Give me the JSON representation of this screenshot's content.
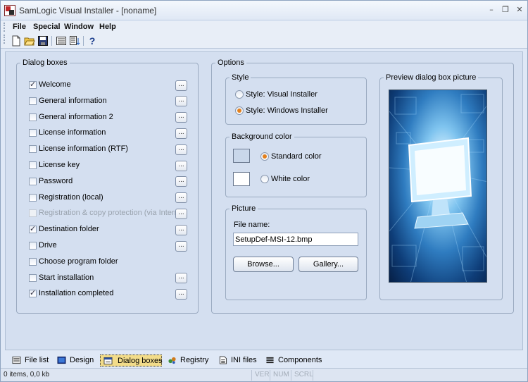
{
  "window": {
    "title": "SamLogic Visual Installer - [noname]"
  },
  "menu": {
    "items": [
      "File",
      "Special",
      "Window",
      "Help"
    ]
  },
  "toolbar": {
    "icons": [
      "new-file-icon",
      "open-folder-icon",
      "save-icon",
      "list-view-icon",
      "import-icon",
      "help-icon"
    ],
    "help_glyph": "?"
  },
  "dialog_boxes": {
    "legend": "Dialog boxes",
    "button_label": "...",
    "items": [
      {
        "label": "Welcome",
        "checked": true,
        "disabled": false,
        "has_button": true
      },
      {
        "label": "General information",
        "checked": false,
        "disabled": false,
        "has_button": true
      },
      {
        "label": "General information 2",
        "checked": false,
        "disabled": false,
        "has_button": true
      },
      {
        "label": "License information",
        "checked": false,
        "disabled": false,
        "has_button": true
      },
      {
        "label": "License information (RTF)",
        "checked": false,
        "disabled": false,
        "has_button": true
      },
      {
        "label": "License key",
        "checked": false,
        "disabled": false,
        "has_button": true
      },
      {
        "label": "Password",
        "checked": false,
        "disabled": false,
        "has_button": true
      },
      {
        "label": "Registration (local)",
        "checked": false,
        "disabled": false,
        "has_button": true
      },
      {
        "label": "Registration & copy protection (via Internet)",
        "checked": false,
        "disabled": true,
        "has_button": true
      },
      {
        "label": "Destination folder",
        "checked": true,
        "disabled": false,
        "has_button": true
      },
      {
        "label": "Drive",
        "checked": false,
        "disabled": false,
        "has_button": true
      },
      {
        "label": "Choose program folder",
        "checked": false,
        "disabled": false,
        "has_button": false
      },
      {
        "label": "Start installation",
        "checked": false,
        "disabled": false,
        "has_button": true
      },
      {
        "label": "Installation completed",
        "checked": true,
        "disabled": false,
        "has_button": true
      }
    ]
  },
  "options": {
    "legend": "Options",
    "style": {
      "legend": "Style",
      "visual_installer": "Style: Visual Installer",
      "windows_installer": "Style: Windows Installer",
      "selected": "windows_installer"
    },
    "background": {
      "legend": "Background color",
      "standard": "Standard color",
      "white": "White color",
      "standard_swatch": "#c9d7ea",
      "white_swatch": "#ffffff",
      "selected": "standard"
    },
    "picture": {
      "legend": "Picture",
      "file_label": "File name:",
      "file_value": "SetupDef-MSI-12.bmp",
      "browse": "Browse...",
      "gallery": "Gallery..."
    },
    "preview": {
      "legend": "Preview dialog box picture"
    }
  },
  "tabs": [
    {
      "label": "File list",
      "icon": "file-list-icon",
      "active": false
    },
    {
      "label": "Design",
      "icon": "design-icon",
      "active": false
    },
    {
      "label": "Dialog boxes",
      "icon": "dialog-boxes-icon",
      "active": true
    },
    {
      "label": "Registry",
      "icon": "registry-icon",
      "active": false
    },
    {
      "label": "INI files",
      "icon": "ini-files-icon",
      "active": false
    },
    {
      "label": "Components",
      "icon": "components-icon",
      "active": false
    }
  ],
  "status": {
    "text": "0 items,   0,0 kb",
    "indicators": [
      "VER",
      "NUM",
      "SCRL"
    ]
  },
  "colors": {
    "accent_orange": "#e27f1c",
    "active_tab": "#f2dc8a",
    "window_bg": "#dfe8f6"
  }
}
